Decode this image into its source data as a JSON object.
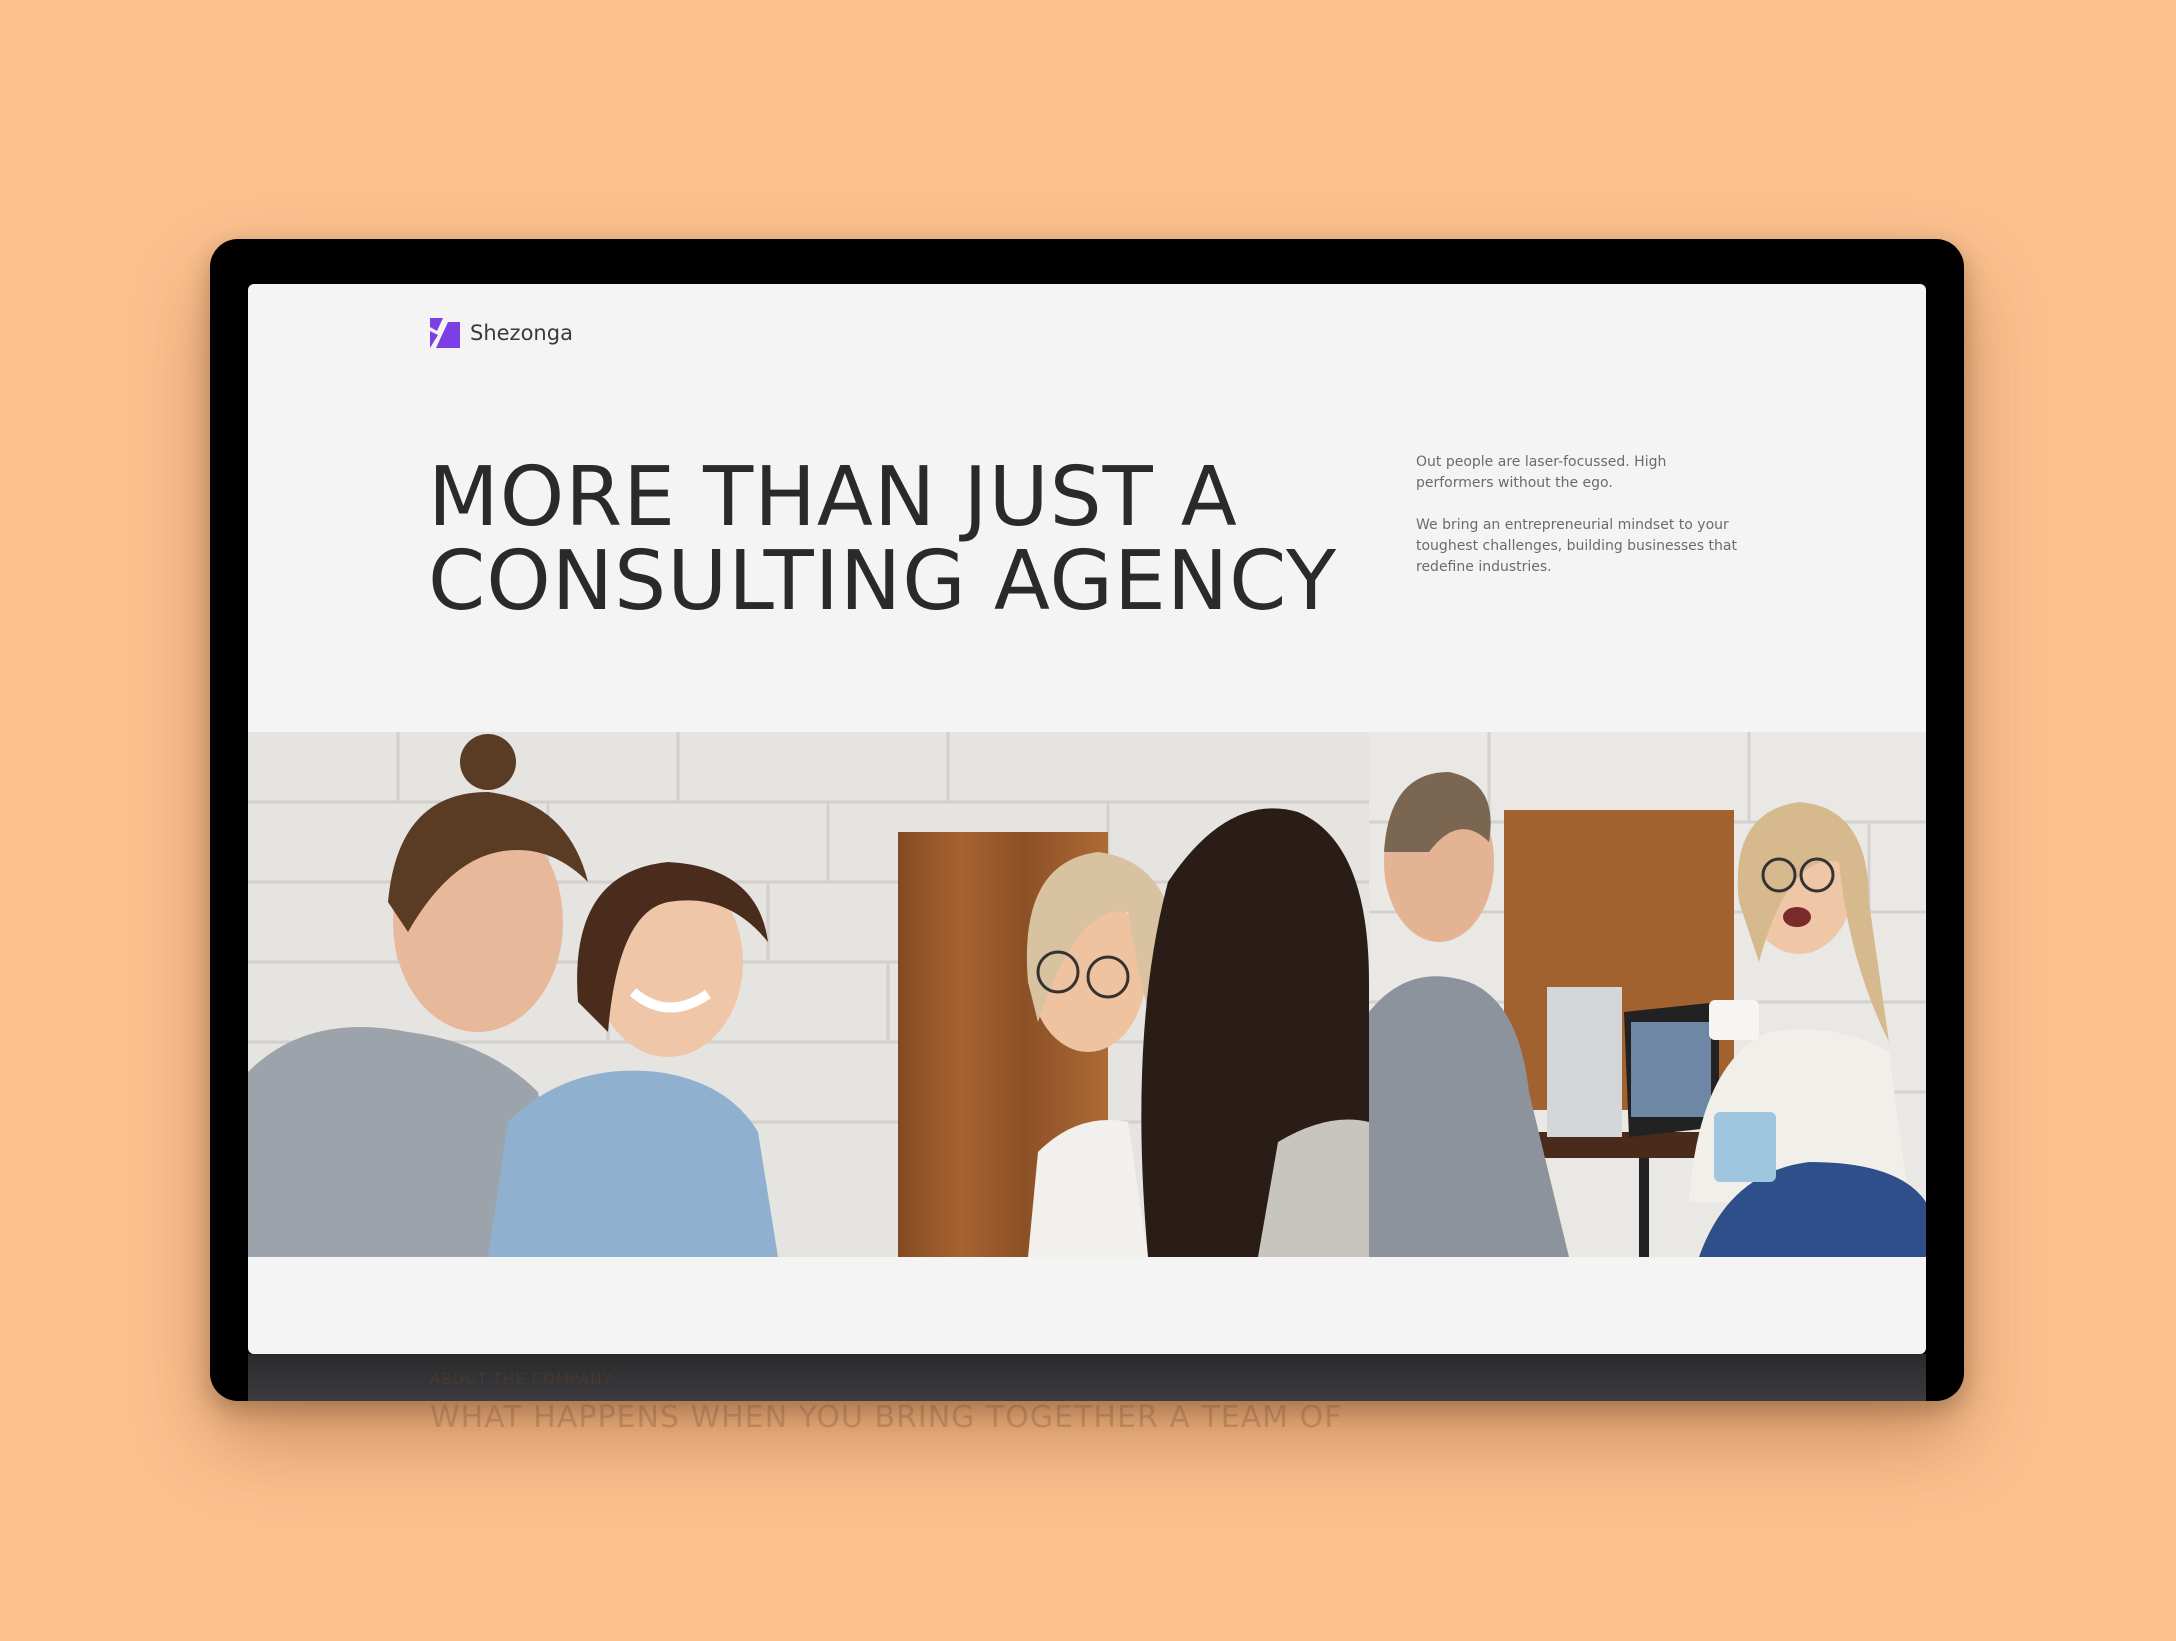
{
  "brand": {
    "name": "Shezonga",
    "accent": "#7b3fe4"
  },
  "hero": {
    "headline_line1": "MORE THAN JUST A",
    "headline_line2": "CONSULTING AGENCY",
    "blurb_1": "Out people are laser-focussed. High performers without the ego.",
    "blurb_2": "We bring an entrepreneurial mindset to your toughest challenges, building businesses that redefine industries."
  },
  "below_fold": {
    "tag": "ABOUT THE COMPANY",
    "headline": "WHAT HAPPENS WHEN YOU BRING TOGETHER A TEAM OF"
  },
  "colors": {
    "background": "#fbc18f",
    "screen": "#f4f4f4",
    "text": "#2a2a2a"
  }
}
